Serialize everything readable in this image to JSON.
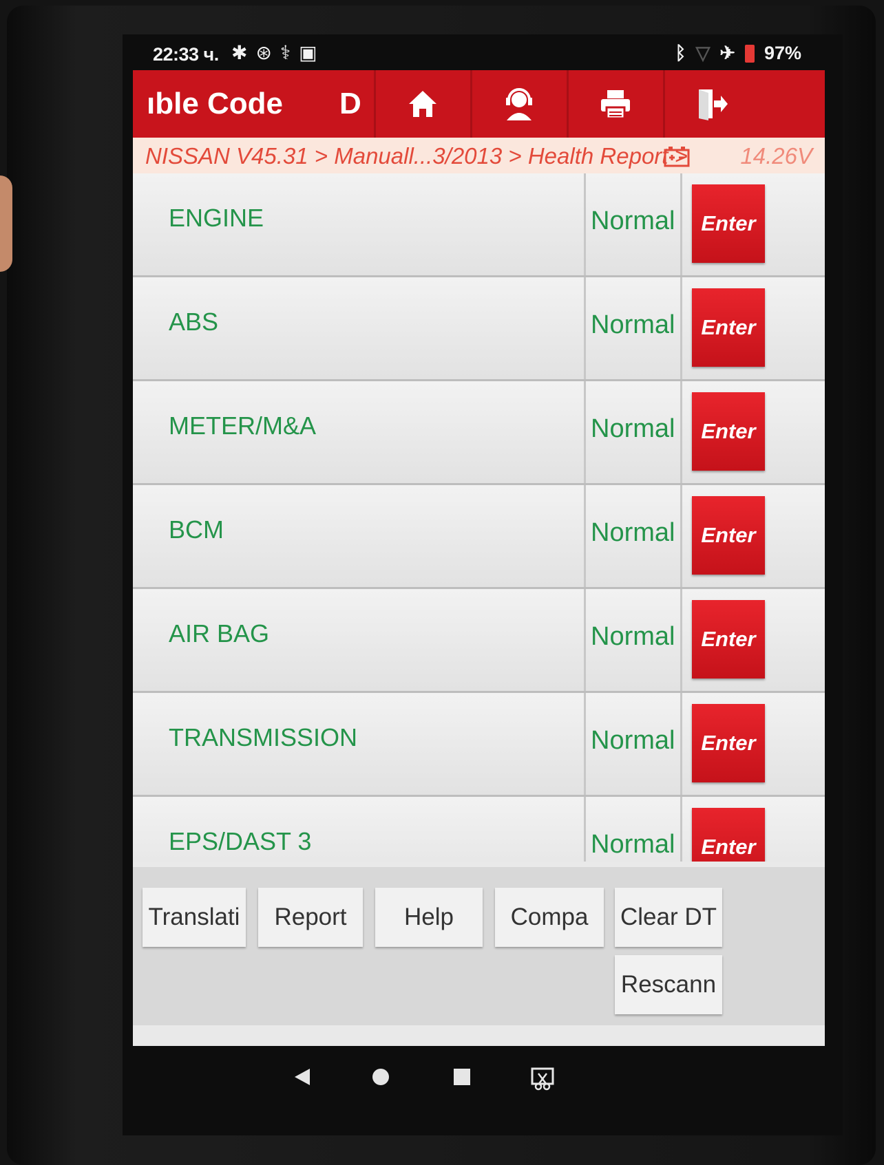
{
  "status_bar": {
    "time": "22:33 ч.",
    "battery": "97%"
  },
  "header": {
    "title": "ıble Code",
    "d_label": "D"
  },
  "breadcrumb": {
    "path": "NISSAN V45.31 > Manuall...3/2013 > Health Report >",
    "voltage": "14.26V"
  },
  "systems": [
    {
      "name": "ENGINE",
      "status": "Normal",
      "button": "Enter"
    },
    {
      "name": "ABS",
      "status": "Normal",
      "button": "Enter"
    },
    {
      "name": "METER/M&A",
      "status": "Normal",
      "button": "Enter"
    },
    {
      "name": "BCM",
      "status": "Normal",
      "button": "Enter"
    },
    {
      "name": "AIR BAG",
      "status": "Normal",
      "button": "Enter"
    },
    {
      "name": "TRANSMISSION",
      "status": "Normal",
      "button": "Enter"
    },
    {
      "name": "EPS/DAST 3",
      "status": "Normal",
      "button": "Enter"
    }
  ],
  "bottom_buttons": {
    "translate": "Translati",
    "report": "Report",
    "help": "Help",
    "compare": "Compa",
    "clear_dtc": "Clear DT",
    "rescan": "Rescann"
  },
  "colors": {
    "brand_red": "#c8141c",
    "status_green": "#24944a"
  }
}
